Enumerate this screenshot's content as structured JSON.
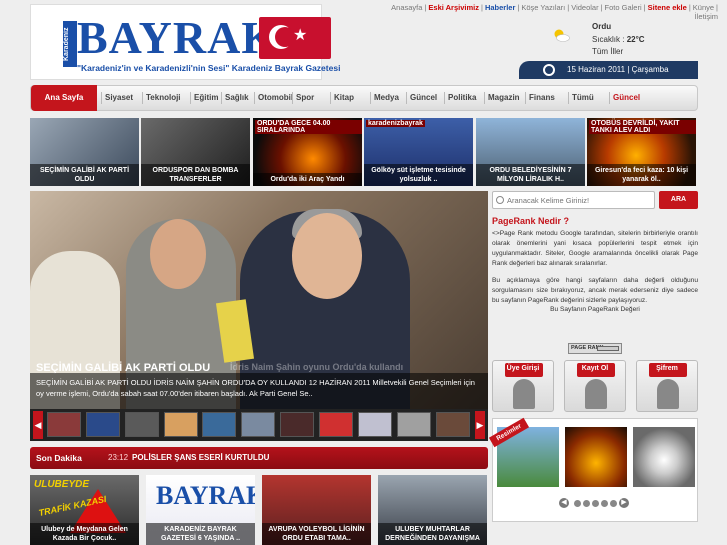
{
  "header": {
    "logo_side": "Karadeniz",
    "logo_word": "BAYRAK",
    "slogan": "\"Karadeniz'in ve Karadenizli'nin Sesi\"  Karadeniz Bayrak Gazetesi",
    "toplinks": [
      {
        "label": "Anasayfa",
        "style": "normal"
      },
      {
        "label": "Eski Arşivimiz",
        "style": "red"
      },
      {
        "label": "Haberler",
        "style": "blue"
      },
      {
        "label": "Köşe Yazıları",
        "style": "normal"
      },
      {
        "label": "Videolar",
        "style": "normal"
      },
      {
        "label": "Foto Galeri",
        "style": "normal"
      },
      {
        "label": "Sitene ekle",
        "style": "red"
      },
      {
        "label": "Künye",
        "style": "normal"
      },
      {
        "label": "İletişim",
        "style": "normal"
      }
    ],
    "weather": {
      "city": "Ordu",
      "temp_label": "Sıcaklık :",
      "temp": "22°C",
      "all": "Tüm İller",
      "icon": "sun-cloud-icon"
    },
    "date": "15 Haziran 2011 | Çarşamba"
  },
  "nav": {
    "home": "Ana Sayfa",
    "items": [
      "Siyaset",
      "Teknoloji",
      "Eğitim",
      "Sağlık",
      "Otomobil",
      "Spor",
      "Kitap",
      "Medya",
      "Güncel",
      "Politika",
      "Magazin",
      "Finans",
      "Tümü"
    ],
    "last": "Güncel"
  },
  "thumbs": [
    {
      "caption": "SEÇİMİN GALİBİ AK PARTİ OLDU",
      "label": ""
    },
    {
      "caption": "ORDUSPOR DAN BOMBA TRANSFERLER",
      "label": ""
    },
    {
      "caption": "Ordu'da iki Araç Yandı",
      "label": "ORDU'DA GECE 04.00 SIRALARINDA"
    },
    {
      "caption": "Gölköy süt işletme tesisinde yolsuzluk ..",
      "label": "karadenizbayrak"
    },
    {
      "caption": "ORDU BELEDİYESİNİN 7 MİLYON LİRALIK H..",
      "label": ""
    },
    {
      "caption": "Giresun'da feci kaza: 10 kişi yanarak öl..",
      "label": "OTOBÜS DEVRİLDİ, YAKIT TANKI ALEV ALDI"
    }
  ],
  "slider": {
    "title": "SEÇİMİN GALİBİ AK PARTİ OLDU",
    "ghost": "İdris Naim Şahin oyunu Ordu'da kullandı",
    "desc": "SEÇİMİN GALİBİ AK PARTİ OLDU İDRİS NAİM ŞAHİN ORDU'DA OY KULLANDI 12 HAZİRAN 2011 Milletvekili Genel Seçimleri için oy verme işlemi, Ordu'da sabah saat 07.00'den itibaren başladı. Ak Parti Genel Se.."
  },
  "sondakika": {
    "label": "Son Dakika",
    "time": "23:12",
    "news": "POLİSLER ŞANS ESERİ KURTULDU"
  },
  "bottom_thumbs": [
    {
      "caption": "Ulubey de Meydana Gelen Kazada Bir Çocuk.."
    },
    {
      "caption": "KARADENİZ BAYRAK GAZETESİ 6 YAŞINDA .."
    },
    {
      "caption": "AVRUPA VOLEYBOL LİGİNİN ORDU ETABI TAMA.."
    },
    {
      "caption": "ULUBEY MUHTARLAR DERNEĞİNDEN DAYANIŞMA"
    }
  ],
  "bottom_overlays": {
    "trafik_top": "ULUBEYDE",
    "trafik_sign": "TRAFİK KAZASI"
  },
  "search": {
    "placeholder": "Aranacak Kelime Giriniz!",
    "button": "ARA"
  },
  "pagerank": {
    "heading": "PageRank Nedir ?",
    "p1": "<>Page Rank metodu Google tarafından, sitelerin birbirleriyle orantılı olarak önemlerini yani kısaca popülerlerini tespit etmek için uygulanmaktadır. Siteler, Google aramalarında öncelikli olarak Page Rank değerleri baz alınarak sıralanırlar.",
    "p2": "Bu açıklamaya göre hangi sayfaların daha değerli olduğunu sorgulamasını size bırakıyoruz, ancak merak ederseniz diye sadece bu sayfanın PageRank değerini sizlerle paylaşıyoruz.",
    "p3": "Bu Sayfanın PageRank Değeri",
    "badge": "PAGE RANK"
  },
  "user_buttons": [
    {
      "label": "Üye Girişi",
      "icon": "user-login-icon"
    },
    {
      "label": "Kayıt Ol",
      "icon": "user-register-icon"
    },
    {
      "label": "Şifrem",
      "icon": "password-icon"
    }
  ],
  "resimler": {
    "label": "Resimler",
    "dot_count": 5
  }
}
